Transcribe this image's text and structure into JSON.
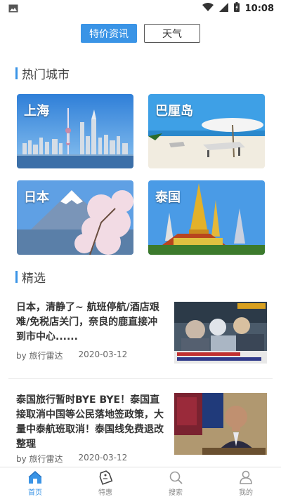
{
  "status_bar": {
    "time": "10:08",
    "icons": [
      "image-icon",
      "wifi-icon",
      "signal-icon",
      "battery-icon"
    ]
  },
  "top_tabs": [
    {
      "label": "特价资讯",
      "active": true
    },
    {
      "label": "天气",
      "active": false
    }
  ],
  "hot_cities": {
    "title": "热门城市",
    "items": [
      {
        "name": "上海"
      },
      {
        "name": "巴厘岛"
      },
      {
        "name": "日本"
      },
      {
        "name": "泰国"
      }
    ]
  },
  "featured": {
    "title": "精选",
    "articles": [
      {
        "title": "日本，清静了~ 航班停航/酒店艰难/免税店关门，奈良的鹿直接冲到市中心......",
        "author": "by 旅行雷达",
        "date": "2020-03-12"
      },
      {
        "title": "泰国旅行暂时BYE BYE！泰国直接取消中国等公民落地签政策，大量中泰航班取消！泰国线免费退改整理",
        "author": "by 旅行雷达",
        "date": "2020-03-12"
      }
    ]
  },
  "bottom_nav": [
    {
      "label": "首页",
      "icon": "home-icon",
      "active": true
    },
    {
      "label": "特惠",
      "icon": "tag-icon",
      "active": false
    },
    {
      "label": "搜索",
      "icon": "search-icon",
      "active": false
    },
    {
      "label": "我的",
      "icon": "user-icon",
      "active": false
    }
  ],
  "colors": {
    "accent": "#3a94e6"
  }
}
